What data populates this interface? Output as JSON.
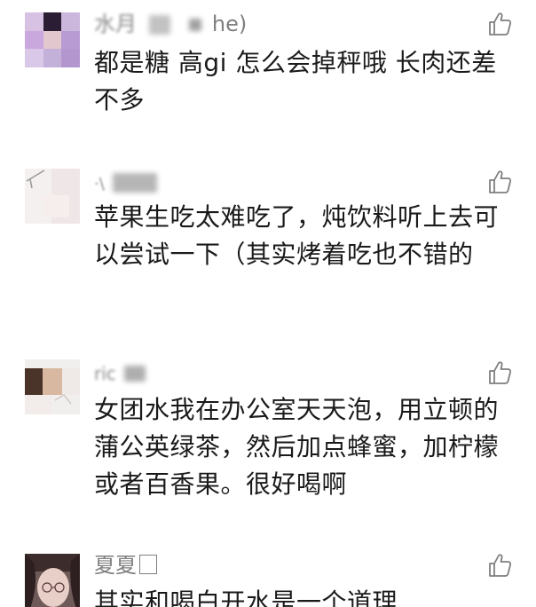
{
  "comments": [
    {
      "username": "水月",
      "username_suffix": "he)",
      "text": "都是糖 高gi 怎么会掉秤哦 长肉还差不多"
    },
    {
      "username": "·\\",
      "username_suffix": "",
      "text": "苹果生吃太难吃了，炖饮料听上去可以尝试一下（其实烤着吃也不错的"
    },
    {
      "username": "ric",
      "username_suffix": "",
      "text": "女团水我在办公室天天泡，用立顿的蒲公英绿茶，然后加点蜂蜜，加柠檬或者百香果。很好喝啊"
    },
    {
      "username": "夏夏",
      "username_suffix": "",
      "text": "其实和喝白开水是一个道理"
    }
  ],
  "icons": {
    "like": "thumbs-up-icon"
  },
  "colors": {
    "username": "#7f7f7f",
    "text": "#1a1a1a",
    "icon": "#7f7f7f"
  }
}
